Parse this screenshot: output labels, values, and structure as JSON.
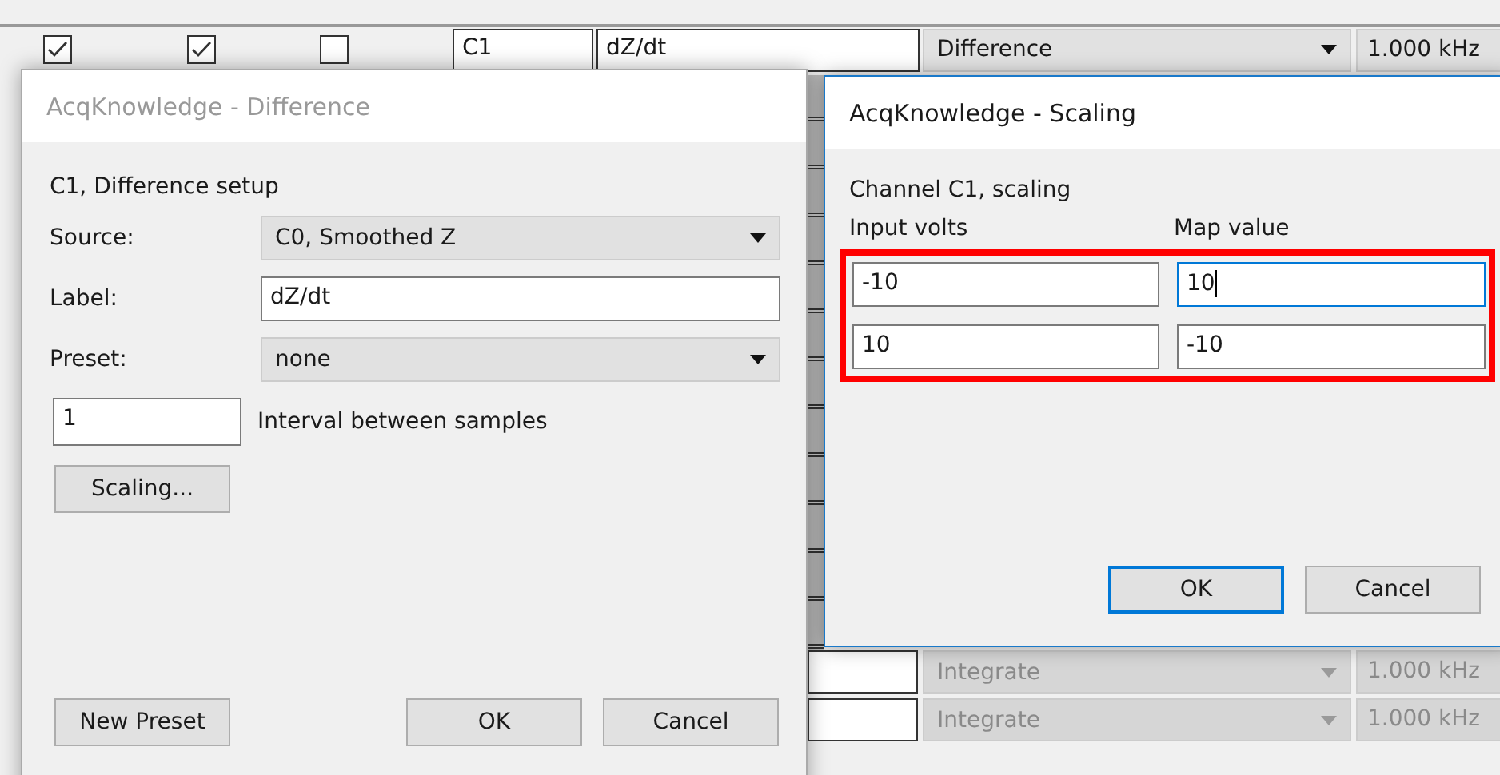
{
  "channel_table": {
    "active_row": {
      "checks": [
        true,
        true,
        false
      ],
      "channel": "C1",
      "label": "dZ/dt",
      "function": "Difference",
      "rate": "1.000 kHz"
    },
    "other_rows": [
      {
        "function": "Integrate",
        "rate": "1.000 kHz",
        "disabled": true
      },
      {
        "function": "Integrate",
        "rate": "1.000 kHz",
        "disabled": true
      }
    ]
  },
  "difference_dialog": {
    "title": "AcqKnowledge - Difference",
    "active": false,
    "heading": "C1, Difference setup",
    "fields": [
      {
        "kind": "dropdown",
        "label": "Source:",
        "value": "C0, Smoothed Z"
      },
      {
        "kind": "text",
        "label": "Label:",
        "value": "dZ/dt"
      },
      {
        "kind": "dropdown",
        "label": "Preset:",
        "value": "none"
      }
    ],
    "interval": {
      "value": "1",
      "label": "Interval between samples"
    },
    "scaling_button": "Scaling...",
    "buttons": [
      "New Preset",
      "OK",
      "Cancel"
    ]
  },
  "scaling_dialog": {
    "title": "AcqKnowledge - Scaling",
    "active": true,
    "heading": "Channel C1, scaling",
    "columns": [
      "Input volts",
      "Map value"
    ],
    "highlighted": true,
    "rows": [
      [
        {
          "value": "-10",
          "focused": false
        },
        {
          "value": "10",
          "focused": true
        }
      ],
      [
        {
          "value": "10",
          "focused": false
        },
        {
          "value": "-10",
          "focused": false
        }
      ]
    ],
    "buttons": [
      {
        "label": "OK",
        "default": true
      },
      {
        "label": "Cancel",
        "default": false
      }
    ]
  }
}
